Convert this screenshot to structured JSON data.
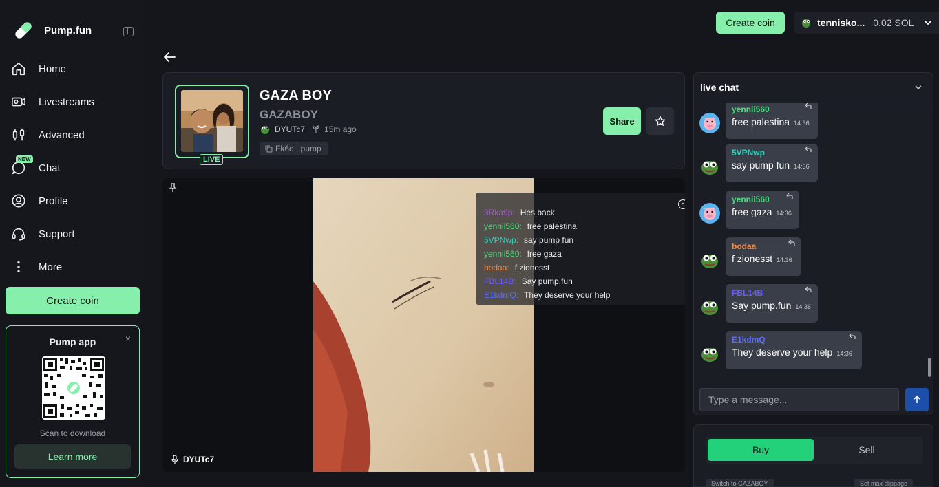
{
  "sidebar": {
    "logo_text": "Pump.fun",
    "nav": [
      {
        "label": "Home",
        "icon": "home-icon"
      },
      {
        "label": "Livestreams",
        "icon": "livestream-icon"
      },
      {
        "label": "Advanced",
        "icon": "candles-icon"
      },
      {
        "label": "Chat",
        "icon": "chat-icon",
        "badge": "NEW"
      },
      {
        "label": "Profile",
        "icon": "profile-icon"
      },
      {
        "label": "Support",
        "icon": "headset-icon"
      },
      {
        "label": "More",
        "icon": "more-icon"
      }
    ],
    "create_coin": "Create coin",
    "app_card": {
      "title": "Pump app",
      "close": "×",
      "scan_text": "Scan to download",
      "learn_more": "Learn more"
    }
  },
  "topbar": {
    "create_coin": "Create coin",
    "wallet_name": "tennisko...",
    "wallet_balance": "0.02 SOL"
  },
  "token": {
    "name": "GAZA BOY",
    "ticker": "GAZABOY",
    "live_label": "LIVE",
    "creator": "DYUTc7",
    "age": "15m ago",
    "contract": "Fk6e...pump",
    "share": "Share"
  },
  "stream": {
    "streamer": "DYUTc7",
    "overlay_messages": [
      {
        "user": "3Rka9p:",
        "text": "Hes back",
        "color": "#a35ad6"
      },
      {
        "user": "yennii560:",
        "text": "free palestina",
        "color": "#4ade80"
      },
      {
        "user": "5VPNwp:",
        "text": "say pump fun",
        "color": "#2dd4bf"
      },
      {
        "user": "yennii560:",
        "text": "free gaza",
        "color": "#4ade80"
      },
      {
        "user": "bodaa:",
        "text": "f zionesst",
        "color": "#f08a4b"
      },
      {
        "user": "FBL14B:",
        "text": "Say pump.fun",
        "color": "#6b5cf6"
      },
      {
        "user": "E1kdmQ:",
        "text": "They deserve your help",
        "color": "#5b6ef5"
      }
    ]
  },
  "chat": {
    "title": "live chat",
    "input_placeholder": "Type a message...",
    "messages": [
      {
        "user": "yennii560",
        "text": "free palestina",
        "time": "14:36",
        "color": "#4ade80",
        "avatar": "pig"
      },
      {
        "user": "5VPNwp",
        "text": "say pump fun",
        "time": "14:36",
        "color": "#2dd4bf",
        "avatar": "pepe"
      },
      {
        "user": "yennii560",
        "text": "free gaza",
        "time": "14:36",
        "color": "#4ade80",
        "avatar": "pig"
      },
      {
        "user": "bodaa",
        "text": "f zionesst",
        "time": "14:36",
        "color": "#f08a4b",
        "avatar": "pepe"
      },
      {
        "user": "FBL14B",
        "text": "Say pump.fun",
        "time": "14:36",
        "color": "#6b5cf6",
        "avatar": "pepe"
      },
      {
        "user": "E1kdmQ",
        "text": "They deserve your help",
        "time": "14:36",
        "color": "#5b6ef5",
        "avatar": "pepe"
      }
    ]
  },
  "trade": {
    "buy": "Buy",
    "sell": "Sell",
    "switch_label": "Switch to GAZABOY",
    "slippage_label": "Set max slippage"
  },
  "colors": {
    "accent": "#86efac",
    "buy_green": "#22d17a",
    "send_blue": "#1e4fa8"
  }
}
